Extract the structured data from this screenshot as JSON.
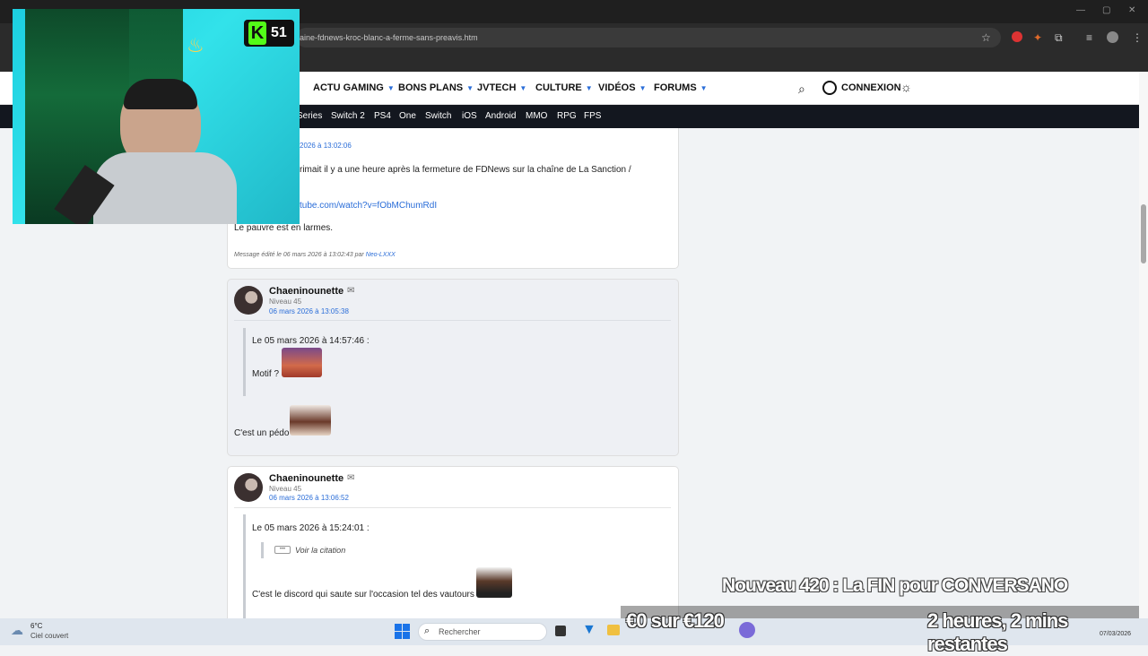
{
  "browser": {
    "url": "aine-fdnews-kroc-blanc-a-ferme-sans-preavis.htm",
    "icons": [
      "star-icon",
      "extension-icon",
      "puzzle-icon",
      "media-icon",
      "profile-icon",
      "menu-icon"
    ]
  },
  "nav": {
    "items": [
      {
        "label": "ACTU GAMING"
      },
      {
        "label": "BONS PLANS"
      },
      {
        "label": "JVTECH"
      },
      {
        "label": "CULTURE"
      },
      {
        "label": "VIDÉOS"
      },
      {
        "label": "FORUMS"
      }
    ],
    "login_label": "CONNEXION"
  },
  "subnav": {
    "items": [
      "Series",
      "Switch 2",
      "PS4",
      "One",
      "Switch",
      "iOS",
      "Android",
      "MMO",
      "RPG",
      "FPS"
    ]
  },
  "posts": [
    {
      "date": "2026 à 13:02:06",
      "line1": "rimait il y a une heure après la fermeture de FDNews sur la chaîne de La Sanction /",
      "link": "tube.com/watch?v=fObMChumRdI",
      "line2": "Le pauvre est en larmes.",
      "edit_prefix": "Message édité le 06 mars 2026 à 13:02:43 par",
      "edit_author": "Neo-LXXX"
    },
    {
      "author": "Chaeninounette",
      "level": "Niveau 45",
      "date": "06 mars 2026 à 13:05:38",
      "quote_header": "Le 05 mars 2026 à 14:57:46 :",
      "quote_text": "Motif ?",
      "text": "C'est un pédo"
    },
    {
      "author": "Chaeninounette",
      "level": "Niveau 45",
      "date": "06 mars 2026 à 13:06:52",
      "quote_header": "Le 05 mars 2026 à 15:24:01 :",
      "nested_quote": "Voir la citation",
      "quote_text": "C'est le discord qui saute sur l'occasion tel des vautours"
    }
  ],
  "webcam": {
    "badge_letter": "K",
    "badge_number": "51"
  },
  "overlay": {
    "title": "Nouveau 420 : La FIN pour CONVERSANO",
    "subgoal": "€0 sur €120",
    "time_left": "2 heures, 2 mins restantes"
  },
  "taskbar": {
    "weather_temp": "6°C",
    "weather_desc": "Ciel couvert",
    "search_placeholder": "Rechercher",
    "date": "07/03/2026"
  },
  "colors": {
    "accent_blue": "#2a6dd8",
    "subnav_bg": "#13171f",
    "badge_green": "#53fc18"
  }
}
